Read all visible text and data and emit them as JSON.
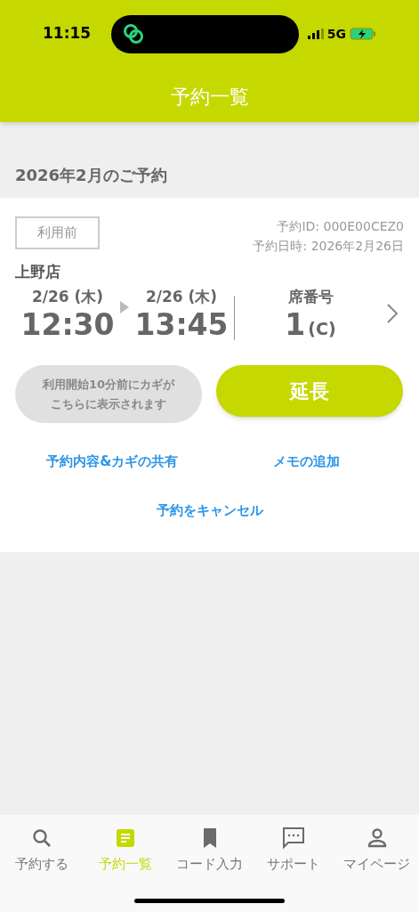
{
  "status_bar": {
    "time": "11:15",
    "network": "5G"
  },
  "header": {
    "title": "予約一覧"
  },
  "section": {
    "title": "2026年2月のご予約"
  },
  "reservation": {
    "status": "利用前",
    "reservation_id": "予約ID: 000E00CEZ0",
    "reservation_date": "予約日時: 2026年2月26日",
    "store": "上野店",
    "start": {
      "date": "2/26 (木)",
      "time": "12:30"
    },
    "end": {
      "date": "2/26 (木)",
      "time": "13:45"
    },
    "seat_label": "席番号",
    "seat_number": "1",
    "seat_type": "(C)",
    "key_notice": "利用開始10分前にカギがこちらに表示されます",
    "extend_button": "延長",
    "links": [
      "予約内容&カギの共有",
      "メモの追加"
    ],
    "cancel_link": "予約をキャンセル"
  },
  "tabs": [
    {
      "kind": "search",
      "label": "予約する",
      "selected": false
    },
    {
      "kind": "list",
      "label": "予約一覧",
      "selected": true
    },
    {
      "kind": "bookmark",
      "label": "コード入力",
      "selected": false
    },
    {
      "kind": "chat",
      "label": "サポート",
      "selected": false
    },
    {
      "kind": "person",
      "label": "マイページ",
      "selected": false
    }
  ]
}
